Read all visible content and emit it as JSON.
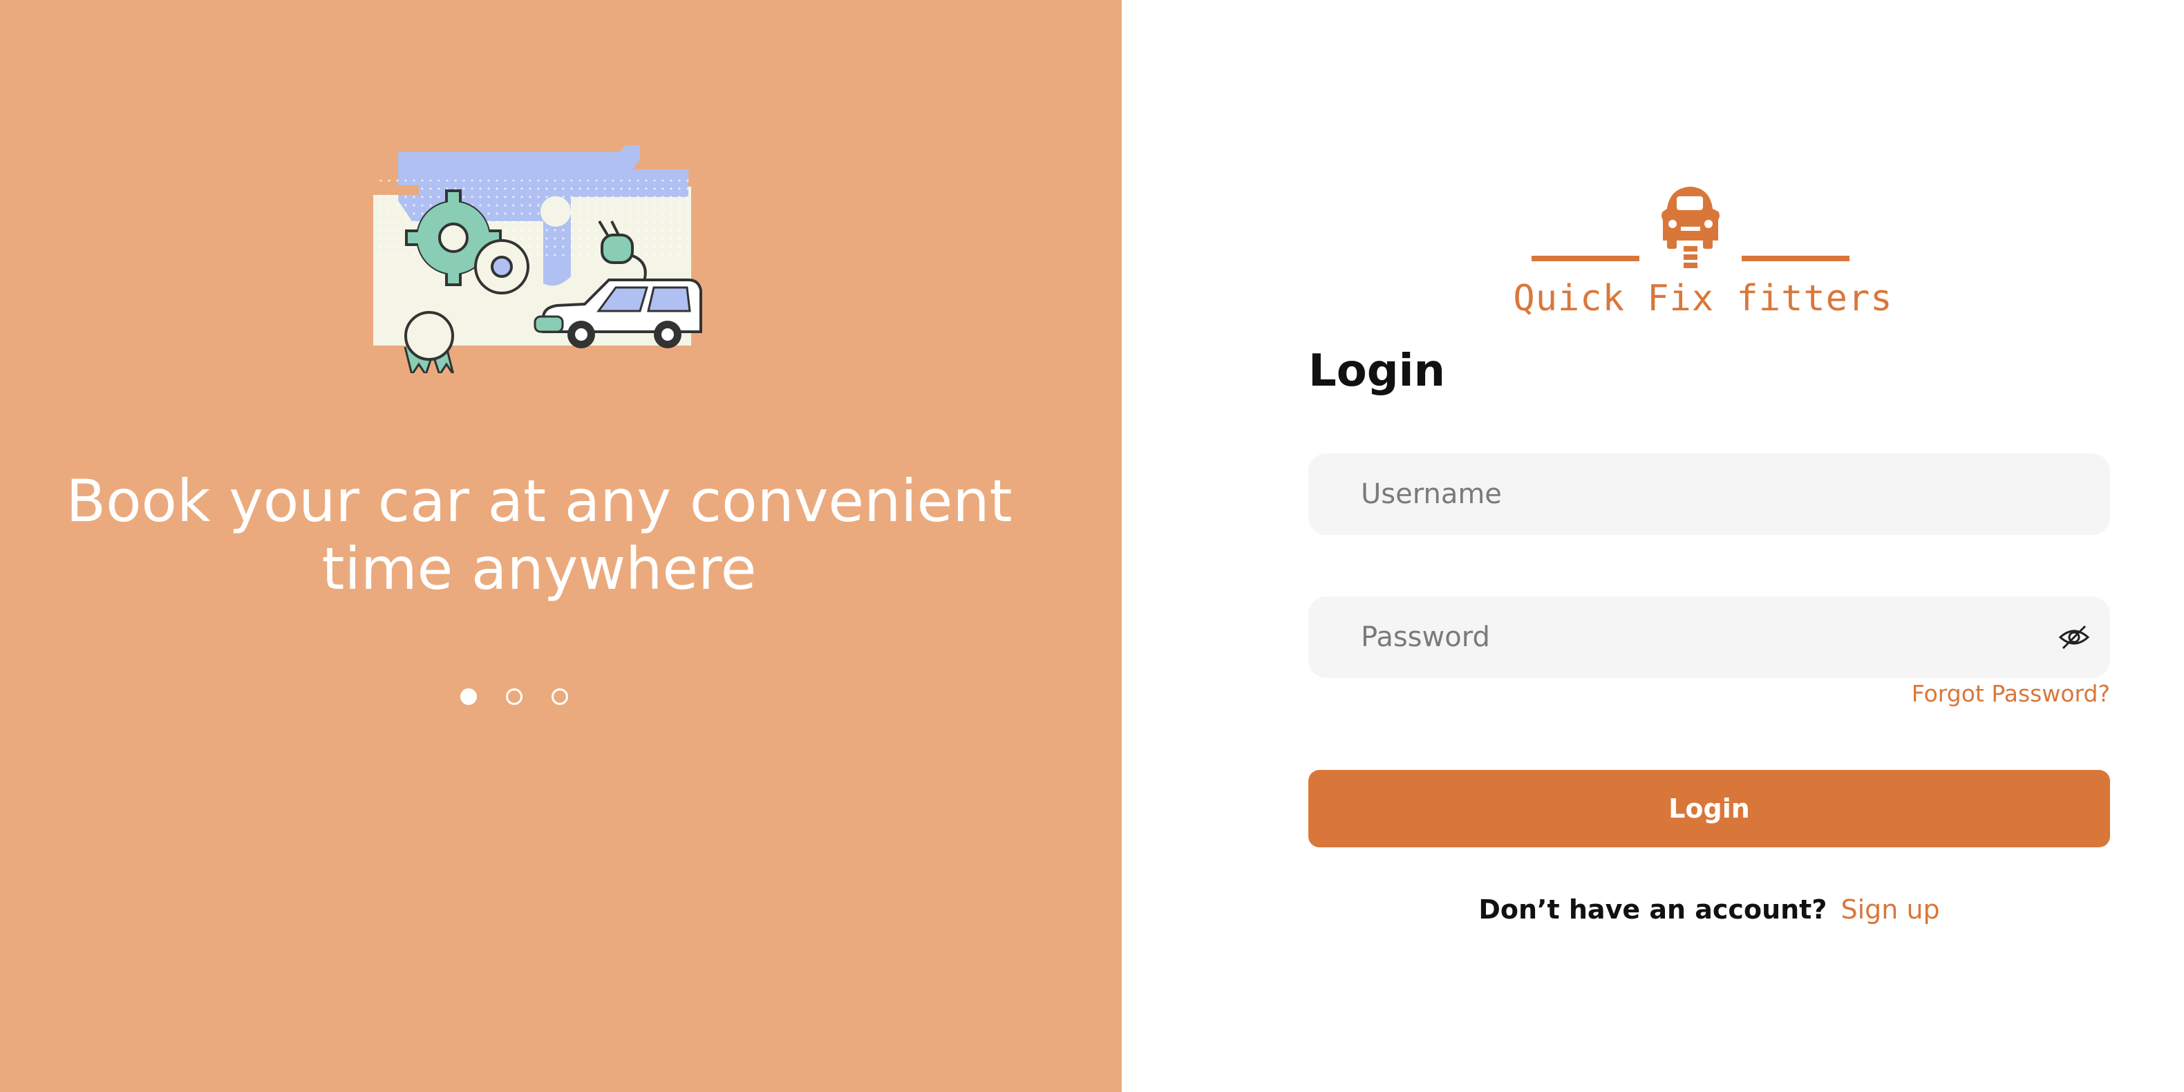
{
  "left_panel": {
    "tagline": "Book your car at any convenient time anywhere",
    "illustration_icon": "car-repair-illustration",
    "carousel": {
      "count": 3,
      "active_index": 0
    },
    "background_color": "#EBAA7D"
  },
  "logo": {
    "icon": "car-spring-icon",
    "text": "Quick Fix fitters"
  },
  "login_form": {
    "title": "Login",
    "username": {
      "placeholder": "Username",
      "value": ""
    },
    "password": {
      "placeholder": "Password",
      "value": "",
      "toggle_icon": "eye-off-icon"
    },
    "forgot_password": "Forgot Password?",
    "submit_label": "Login",
    "signup_prompt": "Don’t have an account?",
    "signup_link": "Sign up"
  },
  "colors": {
    "accent": "#D9773A",
    "input_background": "#F5F5F5",
    "text_dark": "#111111"
  }
}
